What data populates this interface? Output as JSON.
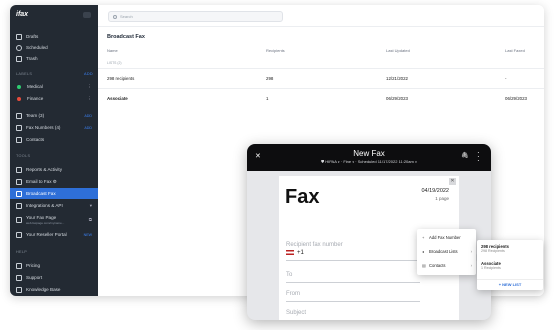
{
  "sidebar": {
    "brand": "ifax",
    "items_top": [
      {
        "label": "Drafts",
        "icon": "document-icon"
      },
      {
        "label": "Scheduled",
        "icon": "clock-icon"
      },
      {
        "label": "Trash",
        "icon": "trash-icon"
      }
    ],
    "labels_heading": "LABELS",
    "labels_add": "ADD",
    "labels": [
      {
        "label": "Medical",
        "color": "#2ecc71"
      },
      {
        "label": "Finance",
        "color": "#e74c3c"
      }
    ],
    "team": {
      "label": "Team (3)",
      "add": "ADD"
    },
    "fax_numbers": {
      "label": "Fax Numbers (4)",
      "add": "ADD"
    },
    "contacts": "Contacts",
    "tools_heading": "TOOLS",
    "tools": [
      {
        "label": "Reports & Activity",
        "icon": "chart-icon"
      },
      {
        "label": "Email to Fax ⚙",
        "icon": "mail-icon"
      },
      {
        "label": "Broadcast Fax",
        "icon": "broadcast-icon",
        "active": true
      },
      {
        "label": "Integrations & API",
        "icon": "integration-icon"
      }
    ],
    "fax_page": {
      "label": "Your Fax Page",
      "sub": "web.faxpage.com/myname..."
    },
    "reseller": {
      "label": "Your Reseller Portal",
      "badge": "NEW"
    },
    "help_heading": "HELP",
    "help": [
      {
        "label": "Pricing"
      },
      {
        "label": "Support"
      },
      {
        "label": "Knowledge Base"
      }
    ]
  },
  "main": {
    "search_placeholder": "Search",
    "title": "Broadcast Fax",
    "columns": [
      "Name",
      "Recipients",
      "Last Updated",
      "Last Faxed"
    ],
    "lists_heading": "LISTS (2)",
    "rows": [
      {
        "name": "298 recipients",
        "recipients": "298",
        "updated": "12/21/2022",
        "faxed": "-"
      },
      {
        "name": "Associate",
        "recipients": "1",
        "updated": "06/29/2023",
        "faxed": "06/29/2023"
      }
    ]
  },
  "modal": {
    "title": "New Fax",
    "hipaa": "HIPAA",
    "quality": "Fine",
    "scheduled": "Scheduled 11/17/2022 11:20am",
    "page": {
      "heading": "Fax",
      "date": "04/19/2022",
      "pages": "1 page",
      "recipient_label": "Recipient fax number",
      "country_code": "+1",
      "to_label": "To",
      "from_label": "From",
      "subject_label": "Subject"
    }
  },
  "dropdown": {
    "items": [
      {
        "label": "Add Fax Number",
        "glyph": "+"
      },
      {
        "label": "Broadcast Lists",
        "glyph": "◂",
        "arrow": "›"
      },
      {
        "label": "Contacts",
        "glyph": "▤",
        "arrow": "›"
      }
    ]
  },
  "submenu": {
    "options": [
      {
        "title": "298 recipients",
        "sub": "298 Recipients"
      },
      {
        "title": "Associate",
        "sub": "1 Recipients"
      }
    ],
    "new_list": "+ NEW LIST"
  }
}
